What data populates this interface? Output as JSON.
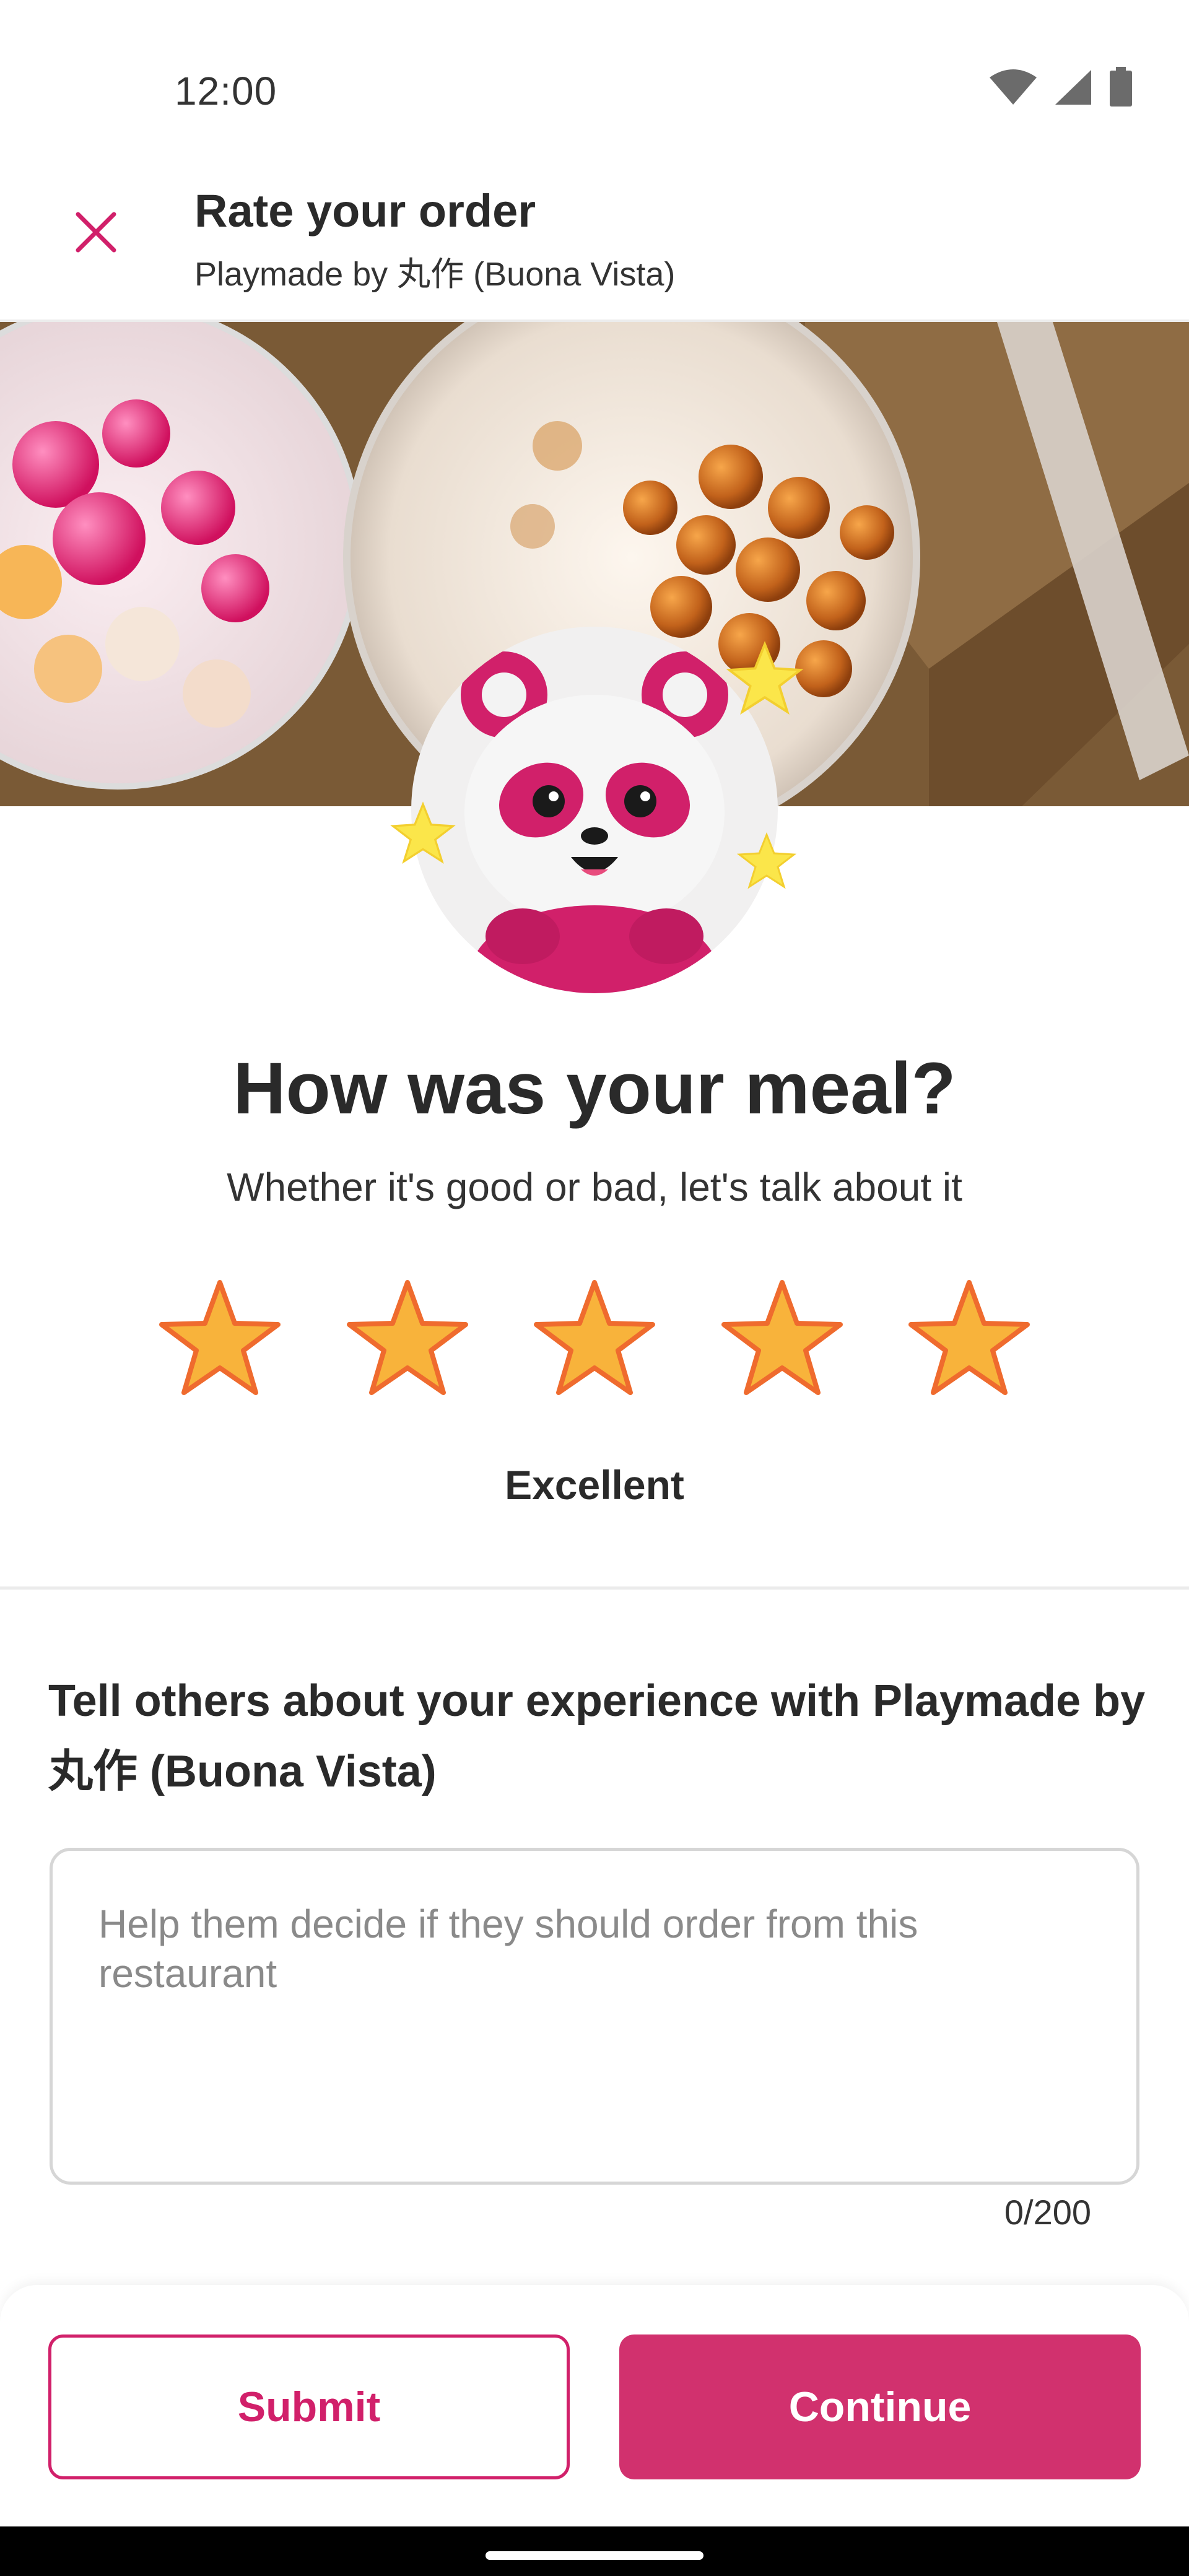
{
  "status_bar": {
    "time": "12:00",
    "icons": [
      "wifi-icon",
      "signal-icon",
      "battery-icon"
    ]
  },
  "header": {
    "title": "Rate your order",
    "subtitle": "Playmade by 丸作 (Buona Vista)"
  },
  "rating": {
    "question": "How was your meal?",
    "prompt": "Whether it's good or bad, let's talk about it",
    "stars_total": 5,
    "stars_selected": 5,
    "label": "Excellent"
  },
  "review": {
    "heading": "Tell others about your experience with Playmade by 丸作 (Buona Vista)",
    "placeholder": "Help them decide if they should order from this restaurant",
    "value": "",
    "char_count": "0/200"
  },
  "footer": {
    "submit_label": "Submit",
    "continue_label": "Continue"
  },
  "colors": {
    "brand": "#d1206a",
    "star_fill": "#f8b33b",
    "star_stroke": "#ef6b2e"
  }
}
